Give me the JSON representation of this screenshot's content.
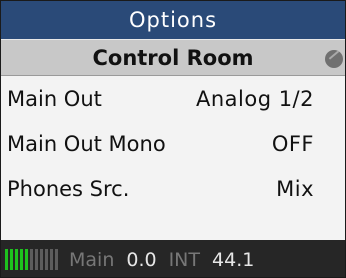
{
  "header": {
    "title": "Options"
  },
  "section": {
    "title": "Control Room"
  },
  "settings": [
    {
      "label": "Main Out",
      "value": "Analog 1/2"
    },
    {
      "label": "Main Out Mono",
      "value": "OFF"
    },
    {
      "label": "Phones Src.",
      "value": "Mix"
    }
  ],
  "status": {
    "meter_level": 0.45,
    "source_label": "Main",
    "level_value": "0.0",
    "clock_label": "INT",
    "sample_rate": "44.1"
  },
  "colors": {
    "title_bg": "#2a4a78",
    "section_bg": "#c8c8c8",
    "meter_on": "#1ec21e",
    "status_bg": "#262626"
  },
  "icons": {
    "section_indicator": "knob-icon"
  }
}
